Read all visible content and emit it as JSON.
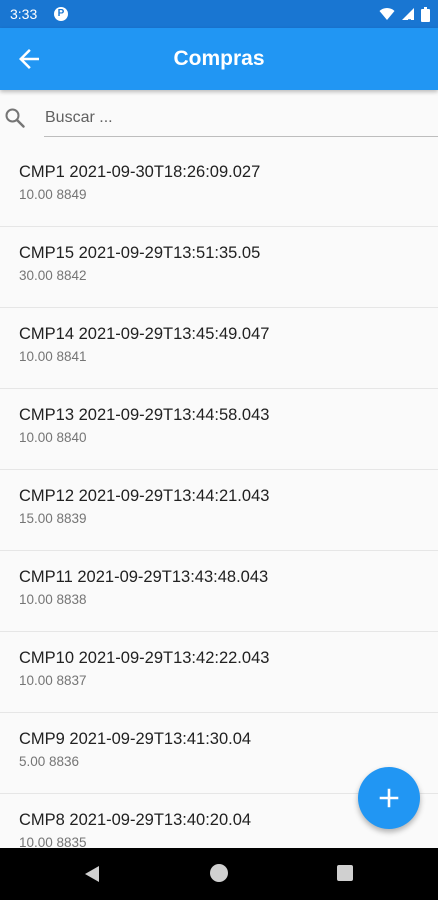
{
  "status_bar": {
    "time": "3:33",
    "app_icon_letter": "P",
    "icons": [
      "wifi-icon",
      "signal-icon",
      "battery-icon"
    ]
  },
  "app_bar": {
    "title": "Compras",
    "back_icon": "arrow-back-icon",
    "color": "#2196f3"
  },
  "search": {
    "placeholder": "Buscar ...",
    "value": ""
  },
  "compras": [
    {
      "title": "CMP1 2021-09-30T18:26:09.027",
      "subtitle": "10.00 8849"
    },
    {
      "title": "CMP15 2021-09-29T13:51:35.05",
      "subtitle": "30.00 8842"
    },
    {
      "title": "CMP14 2021-09-29T13:45:49.047",
      "subtitle": "10.00 8841"
    },
    {
      "title": "CMP13 2021-09-29T13:44:58.043",
      "subtitle": "10.00 8840"
    },
    {
      "title": "CMP12 2021-09-29T13:44:21.043",
      "subtitle": "15.00 8839"
    },
    {
      "title": "CMP11 2021-09-29T13:43:48.043",
      "subtitle": "10.00 8838"
    },
    {
      "title": "CMP10 2021-09-29T13:42:22.043",
      "subtitle": "10.00 8837"
    },
    {
      "title": "CMP9 2021-09-29T13:41:30.04",
      "subtitle": "5.00 8836"
    },
    {
      "title": "CMP8 2021-09-29T13:40:20.04",
      "subtitle": "10.00 8835"
    }
  ],
  "fab": {
    "icon": "plus-icon"
  },
  "nav_bar": {
    "icons": [
      "nav-back-icon",
      "nav-home-icon",
      "nav-recents-icon"
    ]
  }
}
